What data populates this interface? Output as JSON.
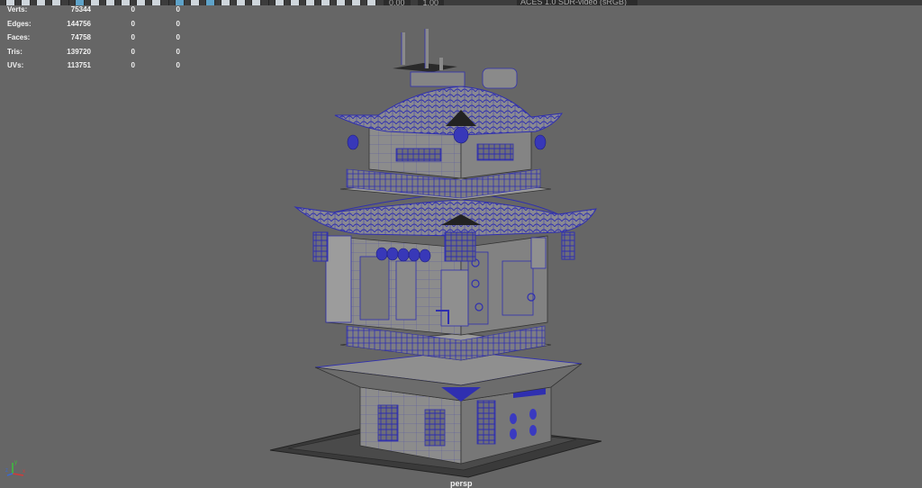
{
  "toolbar": {
    "field_a": "0.00",
    "field_b": "1.00",
    "color_space": "ACES 1.0 SDR-video (sRGB)"
  },
  "hud": {
    "rows": [
      {
        "label": "Verts:",
        "v1": "75344",
        "v2": "0",
        "v3": "0"
      },
      {
        "label": "Edges:",
        "v1": "144756",
        "v2": "0",
        "v3": "0"
      },
      {
        "label": "Faces:",
        "v1": "74758",
        "v2": "0",
        "v3": "0"
      },
      {
        "label": "Tris:",
        "v1": "139720",
        "v2": "0",
        "v3": "0"
      },
      {
        "label": "UVs:",
        "v1": "113751",
        "v2": "0",
        "v3": "0"
      }
    ]
  },
  "viewport": {
    "camera_label": "persp",
    "background_color": "#666666",
    "wireframe_color": "#2f2fb0"
  },
  "axis": {
    "x_label": "x",
    "y_label": "y",
    "z_label": "z"
  }
}
